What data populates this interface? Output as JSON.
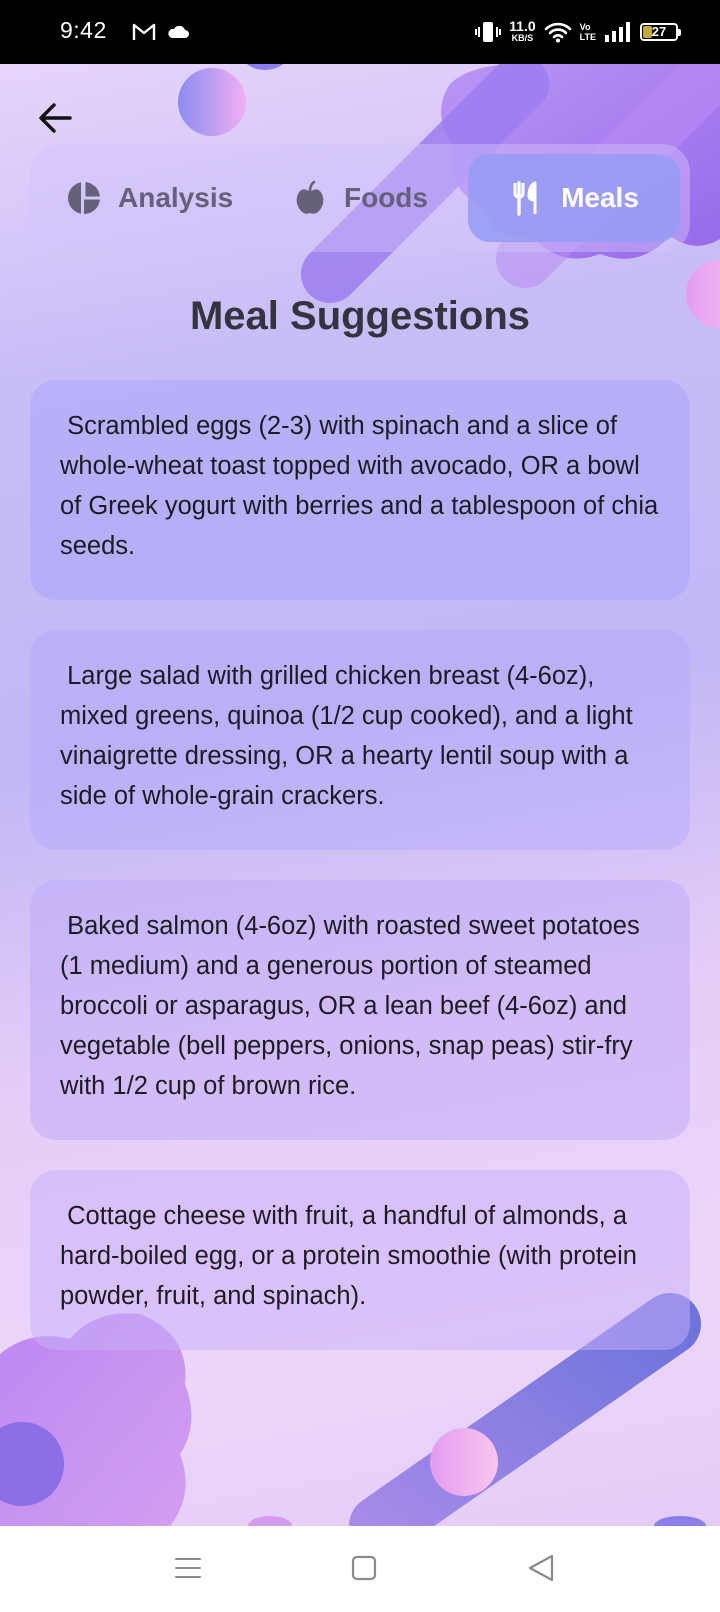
{
  "status_bar": {
    "time": "9:42",
    "icons": [
      "gmail-icon",
      "cloud-icon",
      "vibrate-icon",
      "wifi-icon",
      "volte-icon",
      "signal-icon",
      "battery-icon"
    ],
    "net_speed_value": "11.0",
    "net_speed_unit": "KB/S",
    "volte_top": "Vo",
    "volte_bottom": "LTE",
    "battery_level": "27",
    "battery_fraction": 0.27
  },
  "header": {
    "back_icon": "arrow-left-icon"
  },
  "tabs": [
    {
      "label": "Analysis",
      "icon": "pie-chart-icon",
      "selected": false
    },
    {
      "label": "Foods",
      "icon": "apple-icon",
      "selected": false
    },
    {
      "label": "Meals",
      "icon": "fork-knife-icon",
      "selected": true
    }
  ],
  "page_title": "Meal Suggestions",
  "meals": [
    {
      "text": " Scrambled eggs (2-3) with spinach and a slice of whole-wheat toast topped with avocado, OR a bowl of Greek yogurt with berries and a tablespoon of chia seeds."
    },
    {
      "text": " Large salad with grilled chicken breast (4-6oz), mixed greens, quinoa (1/2 cup cooked), and a light vinaigrette dressing, OR a hearty lentil soup with a side of whole-grain crackers."
    },
    {
      "text": " Baked salmon (4-6oz) with roasted sweet potatoes (1 medium) and a generous portion of steamed broccoli or asparagus, OR a lean beef (4-6oz) and vegetable (bell peppers, onions, snap peas) stir-fry with 1/2 cup of brown rice."
    },
    {
      "text": " Cottage cheese with fruit, a handful of almonds, a hard-boiled egg, or a protein smoothie (with protein powder, fruit, and spinach)."
    }
  ],
  "nav_bar": {
    "icons": [
      "menu-icon",
      "home-square-icon",
      "back-triangle-icon"
    ]
  },
  "colors": {
    "accent": "#9aa0f5",
    "title": "#35333f",
    "tab_inactive": "#66607a"
  }
}
